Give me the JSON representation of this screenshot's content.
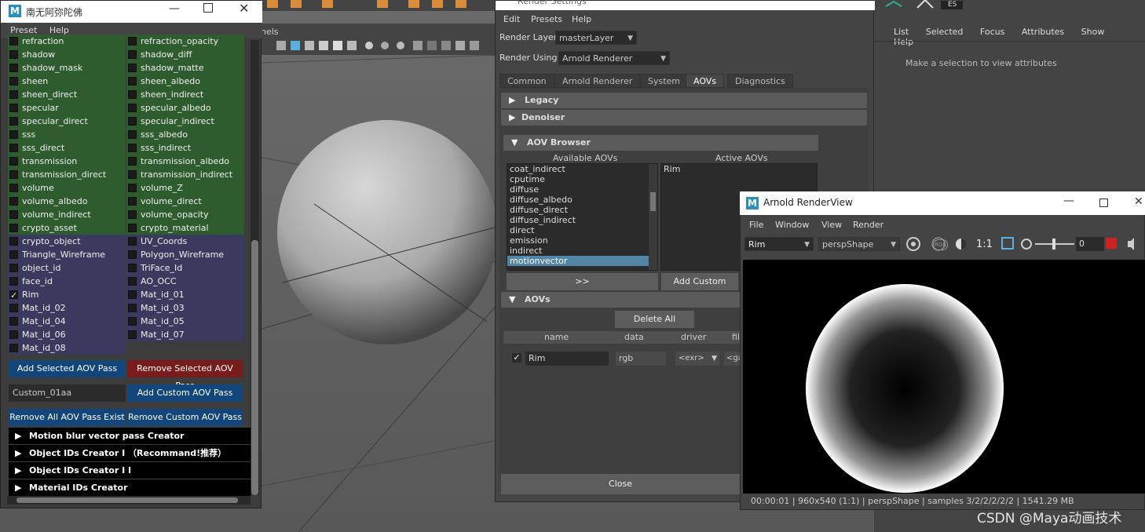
{
  "aov_window": {
    "title": "南无阿弥陀佛",
    "menu": [
      "Preset",
      "Help"
    ],
    "left_col": [
      "refraction",
      "shadow",
      "shadow_mask",
      "sheen",
      "sheen_direct",
      "specular",
      "specular_direct",
      "sss",
      "sss_direct",
      "transmission",
      "transmission_direct",
      "volume",
      "volume_albedo",
      "volume_indirect",
      "crypto_asset",
      "crypto_object",
      "Triangle_Wireframe",
      "object_id",
      "face_id",
      "Rim",
      "Mat_id_02",
      "Mat_id_04",
      "Mat_id_06",
      "Mat_id_08"
    ],
    "right_col": [
      "refraction_opacity",
      "shadow_diff",
      "shadow_matte",
      "sheen_albedo",
      "sheen_indirect",
      "specular_albedo",
      "specular_indirect",
      "sss_albedo",
      "sss_indirect",
      "transmission_albedo",
      "transmission_indirect",
      "volume_Z",
      "volume_direct",
      "volume_opacity",
      "crypto_material",
      "UV_Coords",
      "Polygon_Wireframe",
      "TriFace_Id",
      "AO_OCC",
      "Mat_id_01",
      "Mat_id_03",
      "Mat_id_05",
      "Mat_id_07"
    ],
    "checked_left": "Rim",
    "add_selected": "Add Selected AOV Pass",
    "remove_selected": "Remove Selected AOV Pass",
    "custom_input": "Custom_01aa",
    "add_custom": "Add Custom AOV Pass",
    "remove_all": "Remove All AOV Pass Exist",
    "remove_custom": "Remove Custom AOV Pass",
    "sections": [
      "Motion blur vector pass Creator",
      "Object IDs  Creator I （Recommand!推荐）",
      "Object IDs  Creator I I",
      "Material IDs Creator"
    ],
    "colors": {
      "green": "#2f5c2f",
      "purple": "#3a3a5e",
      "blue": "#12457a",
      "red": "#7a1c1c"
    }
  },
  "viewport": {
    "panel_label": "nels"
  },
  "render_settings": {
    "title": "Render Settings",
    "menu": [
      "Edit",
      "Presets",
      "Help"
    ],
    "render_layer_label": "Render Layer",
    "render_layer_value": "masterLayer",
    "render_using_label": "Render Using",
    "render_using_value": "Arnold Renderer",
    "tabs": [
      "Common",
      "Arnold Renderer",
      "System",
      "AOVs",
      "Diagnostics"
    ],
    "active_tab": "AOVs",
    "frames": [
      "Legacy",
      "Denoiser"
    ],
    "aov_browser": "AOV Browser",
    "available_label": "Available AOVs",
    "active_label": "Active AOVs",
    "available": [
      "coat_indirect",
      "cputime",
      "diffuse",
      "diffuse_albedo",
      "diffuse_direct",
      "diffuse_indirect",
      "direct",
      "emission",
      "indirect",
      "motionvector"
    ],
    "selected_available": "motionvector",
    "active": [
      "Rim"
    ],
    "move_btn": ">>",
    "add_custom": "Add Custom",
    "aovs_frame": "AOVs",
    "delete_all": "Delete All",
    "columns": [
      "name",
      "data",
      "driver",
      "fil"
    ],
    "row": {
      "name": "Rim",
      "data": "rgb",
      "driver": "<exr>",
      "filter": "<ga"
    },
    "close": "Close"
  },
  "attribute_editor": {
    "menu": [
      "List",
      "Selected",
      "Focus",
      "Attributes",
      "Show",
      "Help"
    ],
    "message": "Make a selection to view attributes",
    "badge": "ES"
  },
  "render_view": {
    "title": "Arnold RenderView",
    "menu": [
      "File",
      "Window",
      "View",
      "Render"
    ],
    "aov_select": "Rim",
    "camera_select": "perspShape",
    "ratio": "1:1",
    "exposure_value": "0",
    "rgb_label": "RGB",
    "status": "00:00:01 | 960x540 (1:1) | perspShape  | samples 3/2/2/2/2/2 | 1541.29 MB"
  },
  "watermark": "CSDN @Maya动画技术"
}
